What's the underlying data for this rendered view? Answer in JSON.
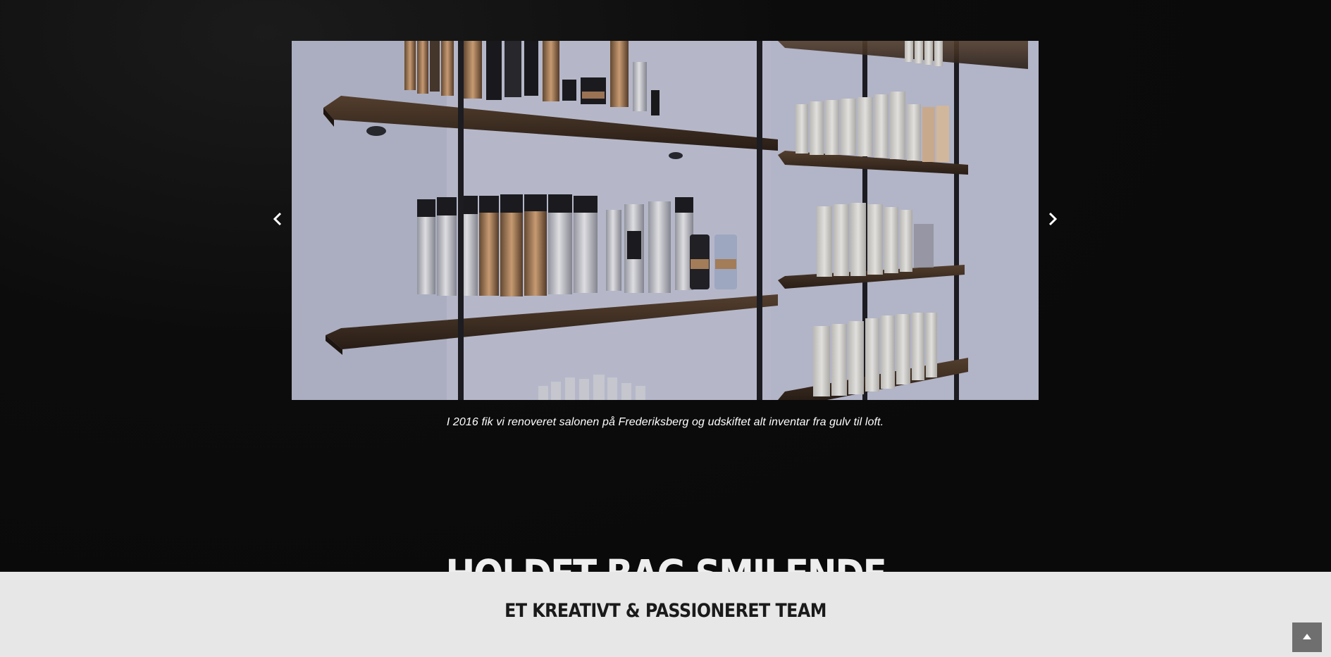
{
  "slider": {
    "caption": "I 2016 fik vi renoveret salonen på Frederiksberg og udskiftet alt inventar fra gulv til loft.",
    "prev_icon": "chevron-left-icon",
    "next_icon": "chevron-right-icon"
  },
  "team": {
    "heading": "HOLDET BAG SMILENDE",
    "subheading": "ET KREATIVT & PASSIONERET TEAM"
  },
  "scroll_top": {
    "icon": "caret-up-icon"
  },
  "colors": {
    "page_background": "#0a0a0a",
    "band_background": "#e7e7e7",
    "caption_text": "#ffffff",
    "heading_text": "#eeeeee",
    "subheading_text": "#1a1a1a",
    "scroll_button": "#6f6f6f"
  }
}
